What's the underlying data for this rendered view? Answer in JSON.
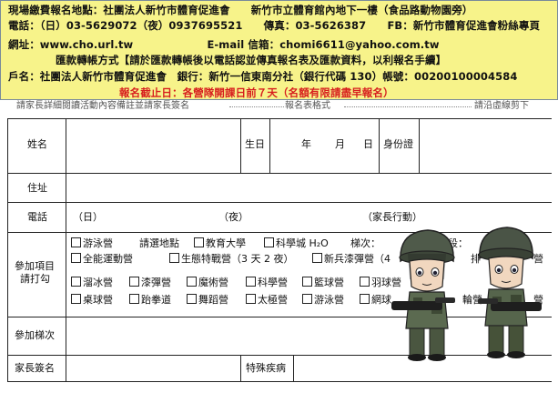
{
  "info": {
    "line1": "現場繳費報名地點：社團法人新竹市體育促進會　　新竹市立體育館內地下一樓（食品路動物園旁）",
    "line2": "電話：（日）03-5629072（夜）0937695521　　傳真：03-5626387　　FB：新竹市體育促進會粉絲專頁",
    "line3": "網址：www.cho.url.tw　　　　　　　E-mail 信箱：chomi6611@yahoo.com.tw",
    "line4": "匯款轉帳方式【請於匯款轉帳後以電話認並傳真報名表及匯款資料，以利報名手續】",
    "line5": "戶名：社團法人新竹市體育促進會　銀行：新竹一信東南分社（銀行代碼 130）帳號：00200100004584",
    "deadline": "報名截止日：各營隊開課日前７天（名額有限請盡早報名）"
  },
  "divider": {
    "left": "請家長詳細閱讀活動內容備註並請家長簽名",
    "middle": "報名表格式",
    "right": "請沿虛線剪下"
  },
  "form": {
    "name_label": "姓名",
    "birthday_label": "生日",
    "year": "年",
    "month": "月",
    "day": "日",
    "id_label": "身份證",
    "address_label": "住址",
    "phone_label": "電話",
    "phone_day": "（日）",
    "phone_night": "（夜）",
    "phone_mobile": "（家長行動）",
    "program_label_1": "參加項目",
    "program_label_2": "請打勾",
    "batch_label": "參加梯次",
    "signature_label": "家長簽名",
    "illness_label": "特殊疾病",
    "row1": {
      "camp": "游泳營",
      "location_prompt": "請選地點",
      "loc1": "教育大學",
      "loc2": "科學城 H₂O",
      "batch": "梯次：",
      "period_frag": "時段："
    },
    "row2": {
      "c1": "全能運動營",
      "c2": "生態特戰營（3 天 2 夜）",
      "c3": "新兵漆彈營（4",
      "c4_frag": "排",
      "c5_frag": "營"
    },
    "row3": [
      "溜冰營",
      "漆彈營",
      "魔術營",
      "科學營",
      "籃球營",
      "羽球營"
    ],
    "row4": [
      "桌球營",
      "跆拳道",
      "舞蹈營",
      "太極營",
      "游泳營",
      "網球",
      "輪營",
      "營"
    ]
  }
}
